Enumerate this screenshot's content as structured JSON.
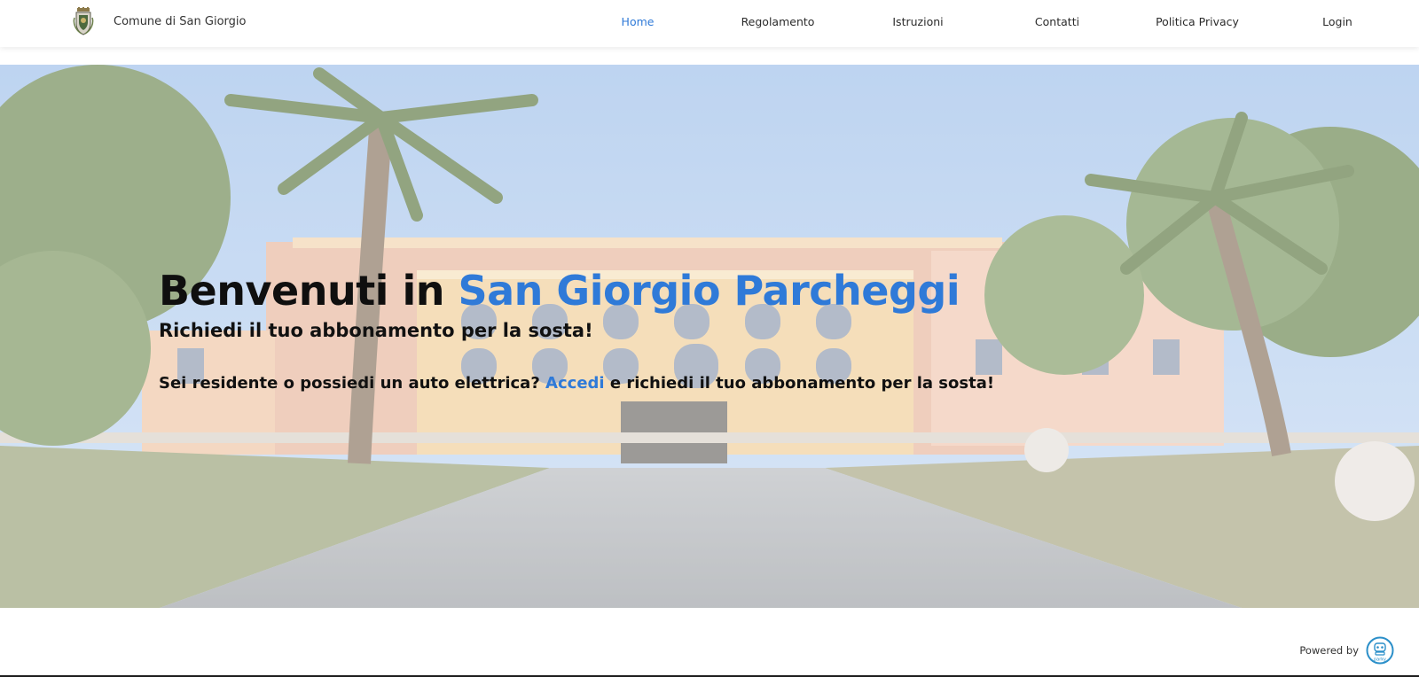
{
  "header": {
    "brand_name": "Comune di San Giorgio",
    "crest_icon": "municipal-crest-icon"
  },
  "nav": {
    "items": [
      {
        "label": "Home",
        "active": true
      },
      {
        "label": "Regolamento",
        "active": false
      },
      {
        "label": "Istruzioni",
        "active": false
      },
      {
        "label": "Contatti",
        "active": false
      },
      {
        "label": "Politica Privacy",
        "active": false
      },
      {
        "label": "Login",
        "active": false
      }
    ]
  },
  "hero": {
    "title_prefix": "Benvenuti in ",
    "title_accent": "San Giorgio Parcheggi",
    "subtitle": "Richiedi il tuo abbonamento per la sosta!",
    "line_prefix": "Sei residente o possiedi un auto elettrica? ",
    "line_link": "Accedi",
    "line_suffix": " e richiedi il tuo abbonamento per la sosta!"
  },
  "footer": {
    "powered_label": "Powered by",
    "powered_logo_icon": "parking-robot-logo-icon",
    "powered_logo_text": "parky"
  },
  "colors": {
    "accent": "#2f7ad8",
    "text": "#111111",
    "header_bg": "#ffffff"
  }
}
